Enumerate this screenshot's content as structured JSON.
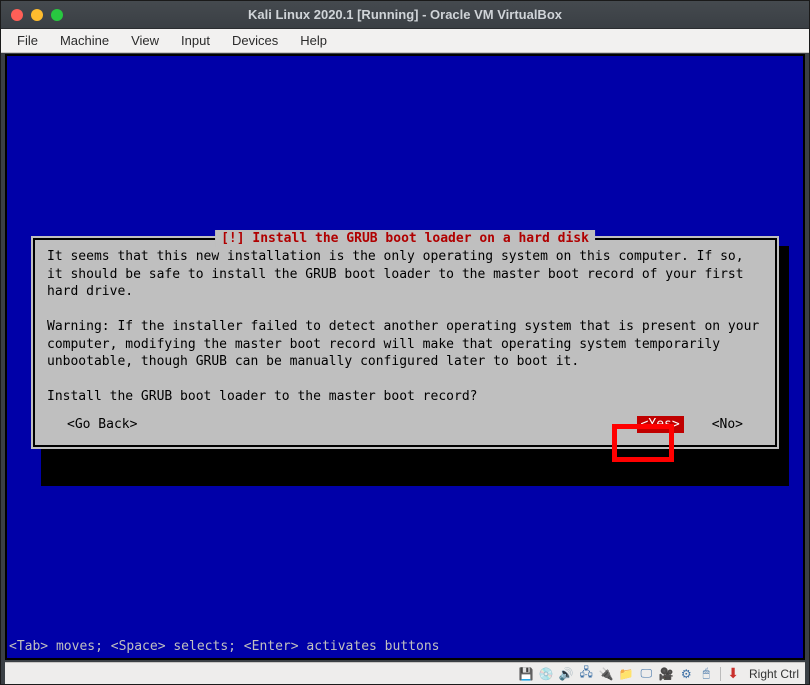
{
  "window": {
    "title": "Kali Linux 2020.1 [Running] - Oracle VM VirtualBox"
  },
  "menubar": {
    "file": "File",
    "machine": "Machine",
    "view": "View",
    "input": "Input",
    "devices": "Devices",
    "help": "Help"
  },
  "dialog": {
    "title": "[!] Install the GRUB boot loader on a hard disk",
    "body1": "It seems that this new installation is the only operating system on this computer. If so, it should be safe to install the GRUB boot loader to the master boot record of your first hard drive.",
    "body2": "Warning: If the installer failed to detect another operating system that is present on your computer, modifying the master boot record will make that operating system temporarily unbootable, though GRUB can be manually configured later to boot it.",
    "question": "Install the GRUB boot loader to the master boot record?",
    "go_back": "<Go Back>",
    "yes": "<Yes>",
    "no": "<No>"
  },
  "footer": {
    "hint": "<Tab> moves; <Space> selects; <Enter> activates buttons"
  },
  "statusbar": {
    "hostkey": "Right Ctrl"
  }
}
